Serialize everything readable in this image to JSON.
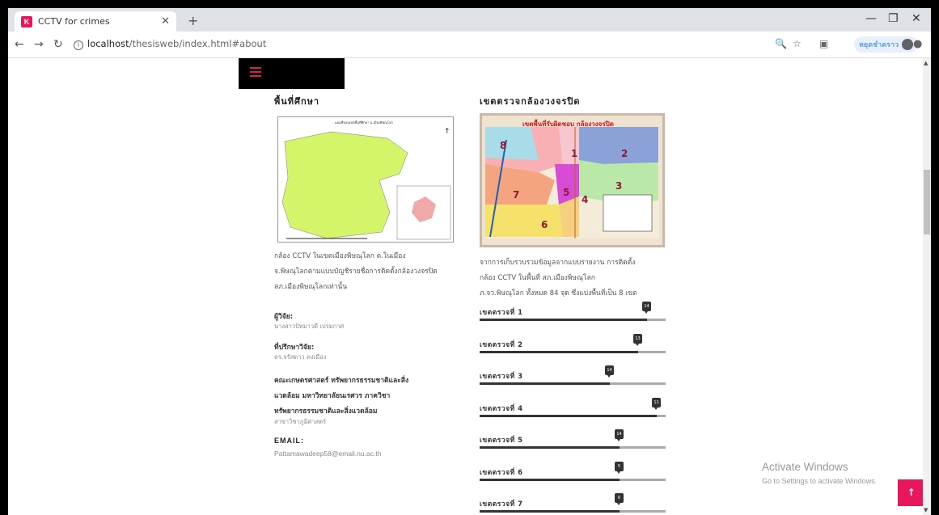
{
  "browser": {
    "tab_title": "CCTV for crimes",
    "favicon_letter": "K",
    "url_host": "localhost",
    "url_path": "/thesisweb/index.html#about",
    "profile_name": "หยุดชำคราว"
  },
  "page": {
    "left": {
      "heading": "พื้นที่ศึกษา",
      "map_title": "แผนที่ขอบเขตพื้นที่ศึกษา อ.เมืองพิษณุโลก",
      "description": [
        "กล้อง CCTV ในเขตเมืองพิษณุโลก ต.ในเมือง",
        "จ.พิษณุโลกตามแบบบัญชีรายชื่อการติดตั้งกล้องวงจรปิด",
        "สภ.เมืองพิษณุโลกเท่านั้น"
      ],
      "researcher_label": "ผู้วิจัย:",
      "researcher_name": "นางสาวปัทมาวดี เปรมกาศ",
      "advisor_label": "ที่ปรึกษาวิจัย:",
      "advisor_name": "ดร.จรัสดาว คงเมือง",
      "faculty_lines": [
        "คณะเกษตรศาสตร์ ทรัพยากรธรรมชาติและสิ่ง",
        "แวดล้อม มหาวิทยาลัยนเรศวร ภาควิชา",
        "ทรัพยากรธรรมชาติและสิ่งแวดล้อม"
      ],
      "faculty_sub": "สาขาวิชาภูมิศาสตร์",
      "email_label": "EMAIL:",
      "email": "Pattamawadeep58@email.nu.ac.th"
    },
    "right": {
      "heading": "เขตตรวจกล้องวงจรปิด",
      "map_title": "เขตพื้นที่รับผิดชอบ กล้องวงจรปิด",
      "zone_numbers": [
        "8",
        "1",
        "2",
        "3",
        "4",
        "5",
        "7",
        "6"
      ],
      "description": [
        "จากการเก็บรวบรวมข้อมูลจากแบบรายงาน การติดตั้ง",
        "กล้อง CCTV ในพื้นที่ สภ.เมืองพิษณุโลก",
        "ภ.จว.พิษณุโลก ทั้งหมด 84 จุด ซึ่งแบ่งพื้นที่เป็น 8 เขต"
      ],
      "zones": [
        {
          "label": "เขตตรวจที่ 1",
          "value": 14,
          "fraction": 0.9
        },
        {
          "label": "เขตตรวจที่ 2",
          "value": 13,
          "fraction": 0.85
        },
        {
          "label": "เขตตรวจที่ 3",
          "value": 14,
          "fraction": 0.7
        },
        {
          "label": "เขตตรวจที่ 4",
          "value": 11,
          "fraction": 0.95
        },
        {
          "label": "เขตตรวจที่ 5",
          "value": 14,
          "fraction": 0.75
        },
        {
          "label": "เขตตรวจที่ 6",
          "value": 5,
          "fraction": 0.75
        },
        {
          "label": "เขตตรวจที่ 7",
          "value": 6,
          "fraction": 0.75
        }
      ]
    }
  },
  "overlay": {
    "activate_title": "Activate Windows",
    "activate_sub": "Go to Settings to activate Windows.",
    "back_to_top": "↑"
  },
  "colors": {
    "accent": "#e8175d",
    "bar_fill": "#333333",
    "bar_track": "#aaaaaa"
  }
}
